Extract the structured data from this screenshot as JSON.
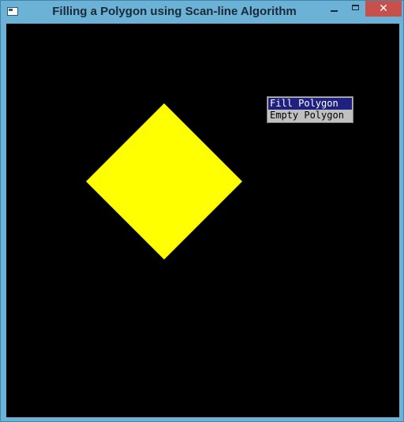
{
  "window": {
    "title": "Filling a Polygon using Scan-line Algorithm",
    "icon": "app-window-icon",
    "controls": {
      "minimize_icon": "minimize-icon",
      "maximize_icon": "maximize-icon",
      "close_glyph": "✕"
    }
  },
  "canvas": {
    "background": "#000000",
    "polygon": {
      "shape": "diamond",
      "fill": "#ffff00"
    }
  },
  "context_menu": {
    "items": [
      {
        "label": "Fill Polygon",
        "selected": true
      },
      {
        "label": "Empty Polygon",
        "selected": false
      }
    ],
    "highlight_color": "#1f2080"
  }
}
